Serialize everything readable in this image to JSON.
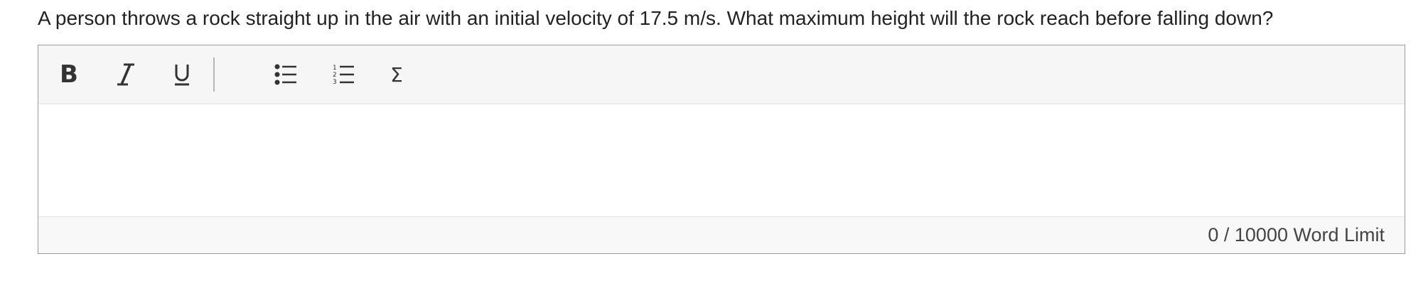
{
  "question": {
    "text": "A person throws a rock straight up in the air with an initial velocity of 17.5 m/s. What maximum height will the rock reach before falling down?"
  },
  "toolbar": {
    "bold_glyph": "B",
    "sigma_glyph": "Σ",
    "buttons": [
      "bold",
      "italic",
      "underline",
      "bulleted-list",
      "numbered-list",
      "equation"
    ]
  },
  "editor": {
    "content": ""
  },
  "status": {
    "word_count": "0",
    "separator": " / ",
    "limit_text": "10000 Word Limit"
  },
  "colors": {
    "toolbar_bg": "#f6f6f6",
    "border": "#9a9a9a",
    "text": "#222222"
  }
}
